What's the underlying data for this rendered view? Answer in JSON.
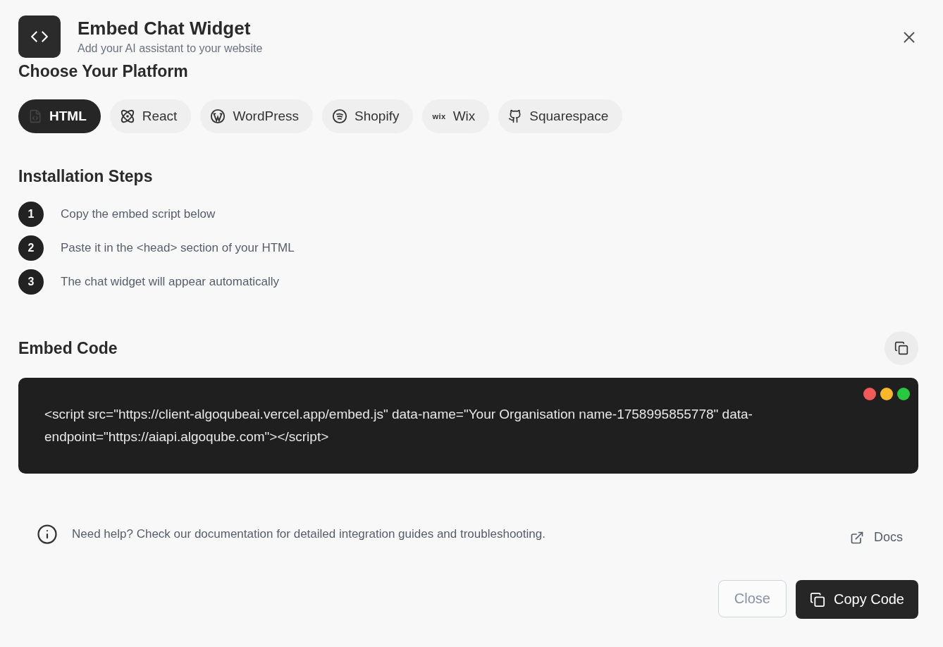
{
  "header": {
    "title": "Embed Chat Widget",
    "subtitle": "Add your AI assistant to your website"
  },
  "platform_section": {
    "title": "Choose Your Platform"
  },
  "platforms": [
    {
      "label": "HTML",
      "kind": "html",
      "selected": true
    },
    {
      "label": "React",
      "kind": "react",
      "selected": false
    },
    {
      "label": "WordPress",
      "kind": "wordpress",
      "selected": false
    },
    {
      "label": "Shopify",
      "kind": "shopify",
      "selected": false
    },
    {
      "label": "Wix",
      "kind": "wix",
      "icon_text": "wix",
      "selected": false
    },
    {
      "label": "Squarespace",
      "kind": "github",
      "selected": false
    }
  ],
  "steps_section": {
    "title": "Installation Steps"
  },
  "steps": [
    {
      "number": "1",
      "text": "Copy the embed script below"
    },
    {
      "number": "2",
      "text": "Paste it in the <head> section of your HTML"
    },
    {
      "number": "3",
      "text": "The chat widget will appear automatically"
    }
  ],
  "embed": {
    "title": "Embed Code",
    "code": "<script src=\"https://client-algoqubeai.vercel.app/embed.js\" data-name=\"Your Organisation name-1758995855778\" data-endpoint=\"https://aiapi.algoqube.com\"></script>",
    "dots": [
      {
        "color": "#f25a5a"
      },
      {
        "color": "#f9b82b"
      },
      {
        "color": "#28c840"
      }
    ]
  },
  "help": {
    "text": "Need help? Check our documentation for detailed integration guides and troubleshooting.",
    "link": "Docs"
  },
  "buttons": {
    "close": "Close",
    "copy": "Copy Code"
  }
}
